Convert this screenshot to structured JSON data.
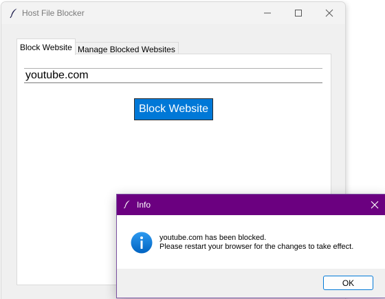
{
  "main_window": {
    "title": "Host File Blocker",
    "icon": "feather-icon",
    "controls": [
      "minimize-icon",
      "maximize-icon",
      "close-icon"
    ]
  },
  "tabs": [
    {
      "label": "Block Website",
      "active": true
    },
    {
      "label": "Manage Blocked Websites",
      "active": false
    }
  ],
  "block_tab": {
    "url_input_value": "youtube.com",
    "block_button_label": "Block Website"
  },
  "dialog": {
    "title": "Info",
    "icon": "info-icon",
    "message_line1": "youtube.com has been blocked.",
    "message_line2": "Please restart your browser for the changes to take effect.",
    "ok_label": "OK"
  },
  "colors": {
    "dialog_titlebar": "#6b0080",
    "accent": "#0078d7"
  }
}
